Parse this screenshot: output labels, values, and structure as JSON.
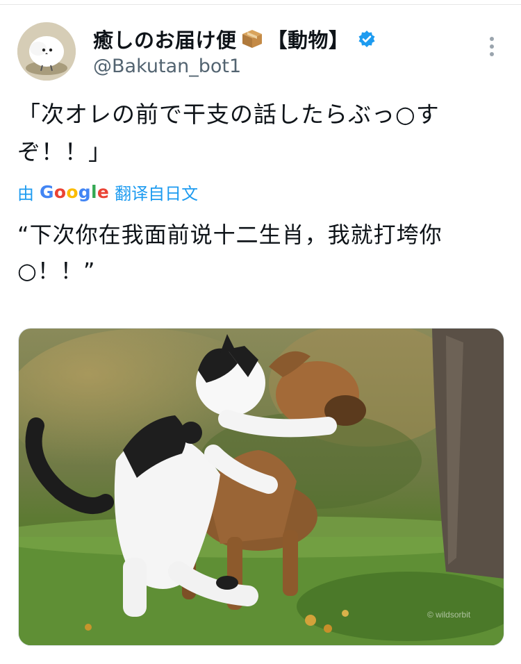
{
  "user": {
    "display_name": "癒しのお届け便",
    "display_tag": "【動物】",
    "handle": "@Bakutan_bot1"
  },
  "tweet": {
    "text_line1": "「次オレの前で干支の話したらぶっ○す",
    "text_line2": "ぞ！！」"
  },
  "translation": {
    "by_label": "由",
    "engine": "Google",
    "suffix": "翻译自日文",
    "text_line1": "“下次你在我面前说十二生肖，我就打垮你",
    "text_line2": "○！！”"
  },
  "media": {
    "description_icon": "photo-cat-and-dog",
    "watermark": "© wildsorbit"
  },
  "colors": {
    "link": "#1d9bf0",
    "verified": "#1d9bf0",
    "secondary_text": "#536471",
    "text": "#0f1419"
  }
}
